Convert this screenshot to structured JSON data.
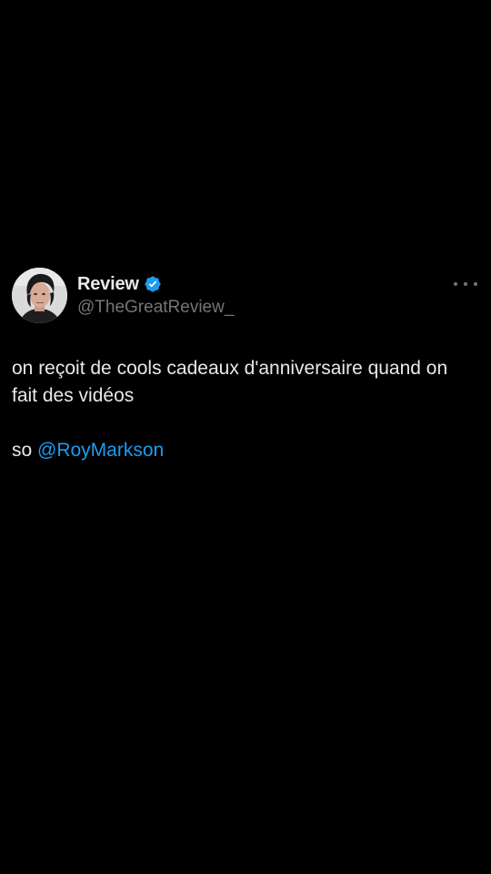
{
  "tweet": {
    "author": {
      "display_name": "Review",
      "handle": "@TheGreatReview_",
      "verified": true,
      "verified_icon": "verified-badge-icon",
      "avatar": "profile-photo"
    },
    "menu_icon": "more-options-icon",
    "text_line_1": "on reçoit de cools cadeaux d'anniversaire quand on fait des vidéos",
    "text_line_2_prefix": "so ",
    "mention": "@RoyMarkson"
  },
  "colors": {
    "background": "#000000",
    "primary_text": "#e7e9ea",
    "secondary_text": "#71767b",
    "accent": "#1d9bf0"
  }
}
